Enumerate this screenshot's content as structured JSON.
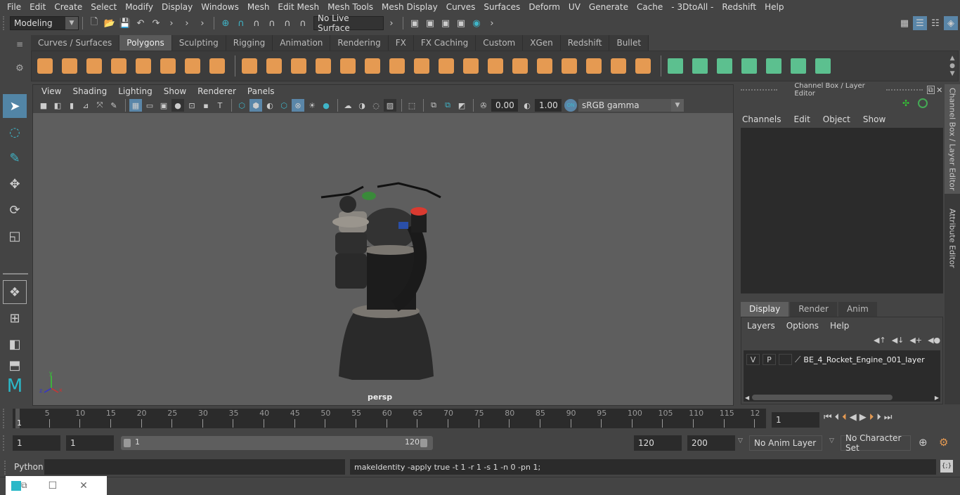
{
  "menubar": [
    "File",
    "Edit",
    "Create",
    "Select",
    "Modify",
    "Display",
    "Windows",
    "Mesh",
    "Edit Mesh",
    "Mesh Tools",
    "Mesh Display",
    "Curves",
    "Surfaces",
    "Deform",
    "UV",
    "Generate",
    "Cache",
    "- 3DtoAll -",
    "Redshift",
    "Help"
  ],
  "status_line": {
    "mode": "Modeling",
    "live_surface": "No Live Surface"
  },
  "shelf_tabs": [
    {
      "label": "Curves / Surfaces",
      "active": false
    },
    {
      "label": "Polygons",
      "active": true
    },
    {
      "label": "Sculpting",
      "active": false
    },
    {
      "label": "Rigging",
      "active": false
    },
    {
      "label": "Animation",
      "active": false
    },
    {
      "label": "Rendering",
      "active": false
    },
    {
      "label": "FX",
      "active": false
    },
    {
      "label": "FX Caching",
      "active": false
    },
    {
      "label": "Custom",
      "active": false
    },
    {
      "label": "XGen",
      "active": false
    },
    {
      "label": "Redshift",
      "active": false
    },
    {
      "label": "Bullet",
      "active": false
    }
  ],
  "shelf_icons": {
    "primitives": [
      "sphere-icon",
      "cube-icon",
      "cylinder-icon",
      "cone-icon",
      "plane-icon",
      "torus-icon",
      "pyramid-icon",
      "pipe-icon"
    ],
    "modeling": [
      "combine-icon",
      "separate-icon",
      "mirror-icon",
      "smooth-icon",
      "extrude-icon",
      "bridge-icon",
      "bevel-icon",
      "multi-cut-icon",
      "target-weld-icon",
      "fill-hole-icon",
      "insert-edge-loop-icon",
      "bridge-edge-icon",
      "extrude-edge-icon",
      "bevel-edge-icon",
      "merge-icon",
      "slide-edge-icon",
      "poke-icon"
    ],
    "uv": [
      "planar-map-icon",
      "cylindrical-map-icon",
      "spherical-map-icon",
      "automatic-map-icon",
      "unfold-icon",
      "uv-editor-icon",
      "layout-uv-icon"
    ]
  },
  "viewport": {
    "menu": [
      "View",
      "Shading",
      "Lighting",
      "Show",
      "Renderer",
      "Panels"
    ],
    "exposure": "0.00",
    "gamma": "1.00",
    "color_management": "sRGB gamma",
    "camera_label": "persp",
    "axis_labels": {
      "x": "x",
      "y": "y",
      "z": "z"
    }
  },
  "channel_box": {
    "title": "Channel Box / Layer Editor",
    "menu": [
      "Channels",
      "Edit",
      "Object",
      "Show"
    ]
  },
  "layer_editor": {
    "tabs": [
      {
        "label": "Display",
        "active": true
      },
      {
        "label": "Render",
        "active": false
      },
      {
        "label": "Anim",
        "active": false
      }
    ],
    "menu": [
      "Layers",
      "Options",
      "Help"
    ],
    "layers": [
      {
        "visible": "V",
        "playback": "P",
        "name": "BE_4_Rocket_Engine_001_layer"
      }
    ]
  },
  "side_tabs": [
    "Channel Box / Layer Editor",
    "Attribute Editor"
  ],
  "timeline": {
    "ticks": [
      "5",
      "10",
      "15",
      "20",
      "25",
      "30",
      "35",
      "40",
      "45",
      "50",
      "55",
      "60",
      "65",
      "70",
      "75",
      "80",
      "85",
      "90",
      "95",
      "100",
      "105",
      "110",
      "115",
      "12"
    ],
    "current_frame_marker": "1",
    "current_frame": "1"
  },
  "range": {
    "start": "1",
    "anim_start": "1",
    "slider_start": "1",
    "slider_end": "120",
    "end": "120",
    "anim_end": "200",
    "anim_layer": "No Anim Layer",
    "character_set": "No Character Set"
  },
  "command_line": {
    "language": "Python",
    "input": "",
    "result": "makeIdentity -apply true -t 1 -r 1 -s 1 -n 0 -pn 1;"
  }
}
